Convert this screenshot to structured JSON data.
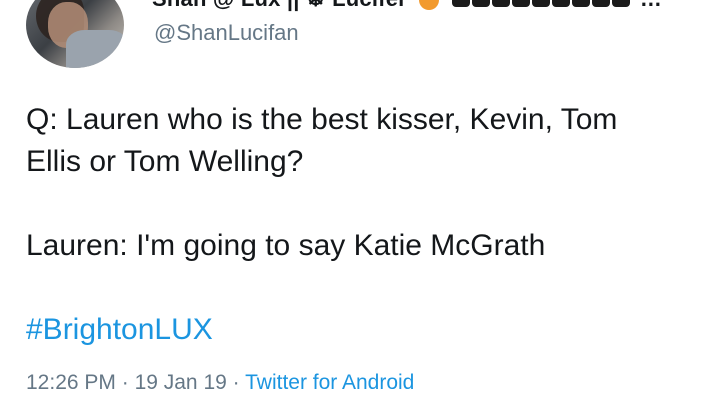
{
  "tweet": {
    "display_name": "Shan @ Lux || ☸ Lucifer",
    "handle": "@ShanLucifan",
    "question_line_1": "Q: Lauren who is the best kisser, Kevin, Tom",
    "question_line_2": "Ellis or Tom Welling?",
    "answer_line": "Lauren: I'm going to say Katie McGrath",
    "hashtag": "#BrightonLUX",
    "time": "12:26 PM",
    "separator": " · ",
    "date": "19 Jan 19",
    "source": "Twitter for Android"
  },
  "colors": {
    "link": "#1b95e0",
    "muted": "#657786",
    "text": "#14171a"
  },
  "icons": {
    "avatar": "profile-photo",
    "emoji": "smiling-face-emoji"
  }
}
